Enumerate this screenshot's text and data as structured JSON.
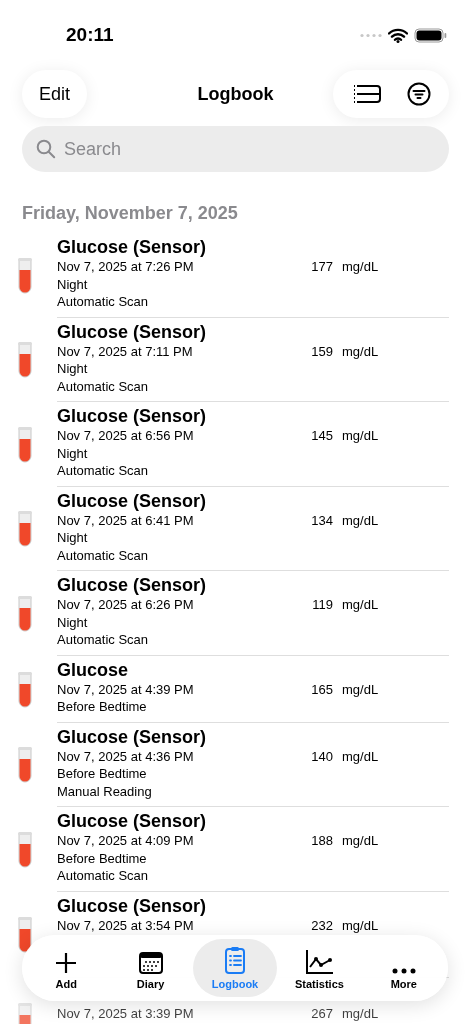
{
  "status_bar": {
    "time": "20:11"
  },
  "nav": {
    "edit": "Edit",
    "title": "Logbook"
  },
  "search": {
    "placeholder": "Search"
  },
  "section": {
    "title": "Friday, November 7, 2025"
  },
  "entries": [
    {
      "title": "Glucose (Sensor)",
      "time": "Nov 7, 2025 at 7:26 PM",
      "value": "177",
      "unit": "mg/dL",
      "lines": [
        "Night",
        "Automatic Scan"
      ]
    },
    {
      "title": "Glucose (Sensor)",
      "time": "Nov 7, 2025 at 7:11 PM",
      "value": "159",
      "unit": "mg/dL",
      "lines": [
        "Night",
        "Automatic Scan"
      ]
    },
    {
      "title": "Glucose (Sensor)",
      "time": "Nov 7, 2025 at 6:56 PM",
      "value": "145",
      "unit": "mg/dL",
      "lines": [
        "Night",
        "Automatic Scan"
      ]
    },
    {
      "title": "Glucose (Sensor)",
      "time": "Nov 7, 2025 at 6:41 PM",
      "value": "134",
      "unit": "mg/dL",
      "lines": [
        "Night",
        "Automatic Scan"
      ]
    },
    {
      "title": "Glucose (Sensor)",
      "time": "Nov 7, 2025 at 6:26 PM",
      "value": "119",
      "unit": "mg/dL",
      "lines": [
        "Night",
        "Automatic Scan"
      ]
    },
    {
      "title": "Glucose",
      "time": "Nov 7, 2025 at 4:39 PM",
      "value": "165",
      "unit": "mg/dL",
      "lines": [
        "Before Bedtime"
      ]
    },
    {
      "title": "Glucose (Sensor)",
      "time": "Nov 7, 2025 at 4:36 PM",
      "value": "140",
      "unit": "mg/dL",
      "lines": [
        "Before Bedtime",
        "Manual Reading"
      ]
    },
    {
      "title": "Glucose (Sensor)",
      "time": "Nov 7, 2025 at 4:09 PM",
      "value": "188",
      "unit": "mg/dL",
      "lines": [
        "Before Bedtime",
        "Automatic Scan"
      ]
    },
    {
      "title": "Glucose (Sensor)",
      "time": "Nov 7, 2025 at 3:54 PM",
      "value": "232",
      "unit": "mg/dL"
    },
    {
      "time": "Nov 7, 2025 at 3:39 PM",
      "value": "267",
      "unit": "mg/dL"
    }
  ],
  "tabs": [
    {
      "kind": "add",
      "label": "Add",
      "selected": false
    },
    {
      "kind": "diary",
      "label": "Diary",
      "selected": false
    },
    {
      "kind": "logbook",
      "label": "Logbook",
      "selected": true
    },
    {
      "kind": "statistics",
      "label": "Statistics",
      "selected": false
    },
    {
      "kind": "more",
      "label": "More",
      "selected": false
    }
  ]
}
